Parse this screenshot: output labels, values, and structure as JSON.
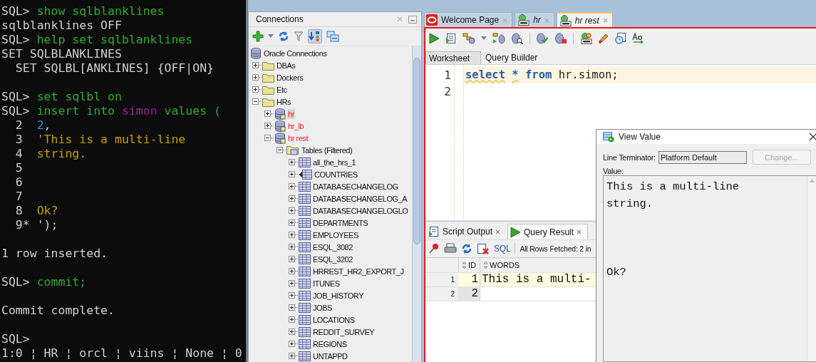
{
  "terminal": {
    "lines": [
      {
        "kind": "text",
        "segments": [
          {
            "text": "SQL> ",
            "kind": "prompt"
          },
          {
            "text": "show sqlblanklines",
            "kind": "command"
          }
        ]
      },
      {
        "kind": "text",
        "segments": [
          {
            "text": "sqlblanklines OFF",
            "kind": "output"
          }
        ]
      },
      {
        "kind": "text",
        "segments": [
          {
            "text": "SQL> ",
            "kind": "prompt"
          },
          {
            "text": "help set sqlblanklines",
            "kind": "command"
          }
        ]
      },
      {
        "kind": "text",
        "segments": [
          {
            "text": "SET SQLBLANKLINES",
            "kind": "output"
          }
        ]
      },
      {
        "kind": "text",
        "segments": [
          {
            "text": "  SET SQLBL[ANKLINES] {OFF|ON}",
            "kind": "output"
          }
        ]
      },
      {
        "kind": "blank"
      },
      {
        "kind": "text",
        "segments": [
          {
            "text": "SQL> ",
            "kind": "prompt"
          },
          {
            "text": "set sqlbl on",
            "kind": "command"
          }
        ]
      },
      {
        "kind": "text",
        "segments": [
          {
            "text": "SQL> ",
            "kind": "prompt"
          },
          {
            "text": "insert into ",
            "kind": "command"
          },
          {
            "text": "simon",
            "kind": "identifier"
          },
          {
            "text": " values (",
            "kind": "command"
          }
        ]
      },
      {
        "kind": "text",
        "segments": [
          {
            "text": "  2  ",
            "kind": "prompt"
          },
          {
            "text": "2",
            "kind": "number"
          },
          {
            "text": ",",
            "kind": "output"
          }
        ]
      },
      {
        "kind": "text",
        "segments": [
          {
            "text": "  3  ",
            "kind": "prompt"
          },
          {
            "text": "'This is a multi-line",
            "kind": "string"
          }
        ]
      },
      {
        "kind": "text",
        "segments": [
          {
            "text": "  4  ",
            "kind": "prompt"
          },
          {
            "text": "string.",
            "kind": "string"
          }
        ]
      },
      {
        "kind": "text",
        "segments": [
          {
            "text": "  5",
            "kind": "prompt"
          }
        ]
      },
      {
        "kind": "text",
        "segments": [
          {
            "text": "  6",
            "kind": "prompt"
          }
        ]
      },
      {
        "kind": "text",
        "segments": [
          {
            "text": "  7",
            "kind": "prompt"
          }
        ]
      },
      {
        "kind": "text",
        "segments": [
          {
            "text": "  8  ",
            "kind": "prompt"
          },
          {
            "text": "Ok?",
            "kind": "string"
          }
        ]
      },
      {
        "kind": "text",
        "segments": [
          {
            "text": "  9* ",
            "kind": "prompt"
          },
          {
            "text": "');",
            "kind": "output"
          }
        ]
      },
      {
        "kind": "blank"
      },
      {
        "kind": "text",
        "segments": [
          {
            "text": "1 row inserted.",
            "kind": "output"
          }
        ]
      },
      {
        "kind": "blank"
      },
      {
        "kind": "text",
        "segments": [
          {
            "text": "SQL> ",
            "kind": "prompt"
          },
          {
            "text": "commit;",
            "kind": "command"
          }
        ]
      },
      {
        "kind": "blank"
      },
      {
        "kind": "text",
        "segments": [
          {
            "text": "Commit complete.",
            "kind": "output"
          }
        ]
      },
      {
        "kind": "blank"
      },
      {
        "kind": "text",
        "segments": [
          {
            "text": "SQL>",
            "kind": "prompt"
          }
        ]
      }
    ],
    "status_bar": "1:0 ¦ HR ¦ orcl ¦ viins ¦ None ¦ 0"
  },
  "connections": {
    "title": "Connections",
    "tree": [
      {
        "label": "Oracle Connections",
        "kind": "root",
        "selected": false,
        "children": [
          {
            "label": "DBAs",
            "kind": "folder",
            "expanded": false,
            "selected": false
          },
          {
            "label": "Dockers",
            "kind": "folder",
            "expanded": false,
            "selected": false
          },
          {
            "label": "Etc",
            "kind": "folder",
            "expanded": false,
            "selected": false
          },
          {
            "label": "HRs",
            "kind": "folder",
            "expanded": true,
            "selected": false,
            "children": [
              {
                "label": "hr",
                "kind": "connection",
                "expanded": false,
                "selected": true
              },
              {
                "label": "hr_lb",
                "kind": "connection",
                "expanded": false,
                "selected": false
              },
              {
                "label": "hr rest",
                "kind": "connection",
                "expanded": true,
                "selected": false,
                "children": [
                  {
                    "label": "Tables (Filtered)",
                    "kind": "tables",
                    "expanded": true,
                    "selected": false,
                    "children": [
                      {
                        "label": "all_the_hrs_1",
                        "kind": "table",
                        "expanded": false,
                        "selected": false
                      },
                      {
                        "label": "COUNTRIES",
                        "kind": "external",
                        "expanded": false,
                        "selected": false
                      },
                      {
                        "label": "DATABASECHANGELOG",
                        "kind": "table",
                        "expanded": false,
                        "selected": false
                      },
                      {
                        "label": "DATABASECHANGELOG_A",
                        "kind": "table",
                        "expanded": false,
                        "selected": false
                      },
                      {
                        "label": "DATABASECHANGELOGLO",
                        "kind": "table",
                        "expanded": false,
                        "selected": false
                      },
                      {
                        "label": "DEPARTMENTS",
                        "kind": "table",
                        "expanded": false,
                        "selected": false
                      },
                      {
                        "label": "EMPLOYEES",
                        "kind": "table",
                        "expanded": false,
                        "selected": false
                      },
                      {
                        "label": "ESQL_3082",
                        "kind": "table",
                        "expanded": false,
                        "selected": false
                      },
                      {
                        "label": "ESQL_3202",
                        "kind": "table",
                        "expanded": false,
                        "selected": false
                      },
                      {
                        "label": "HRREST_HR2_EXPORT_J",
                        "kind": "table",
                        "expanded": false,
                        "selected": false
                      },
                      {
                        "label": "ITUNES",
                        "kind": "table",
                        "expanded": false,
                        "selected": false
                      },
                      {
                        "label": "JOB_HISTORY",
                        "kind": "table",
                        "expanded": false,
                        "selected": false
                      },
                      {
                        "label": "JOBS",
                        "kind": "table",
                        "expanded": false,
                        "selected": false
                      },
                      {
                        "label": "LOCATIONS",
                        "kind": "table",
                        "expanded": false,
                        "selected": false
                      },
                      {
                        "label": "REDDIT_SURVEY",
                        "kind": "table",
                        "expanded": false,
                        "selected": false
                      },
                      {
                        "label": "REGIONS",
                        "kind": "table",
                        "expanded": false,
                        "selected": false
                      },
                      {
                        "label": "UNTAPPD",
                        "kind": "table",
                        "expanded": false,
                        "selected": false
                      }
                    ]
                  }
                ]
              }
            ]
          }
        ]
      }
    ]
  },
  "editor": {
    "tabs": [
      {
        "label": "Welcome Page",
        "kind": "welcome",
        "selected": false
      },
      {
        "label": "hr",
        "kind": "sql",
        "selected": false
      },
      {
        "label": "hr rest",
        "kind": "sql",
        "selected": true
      }
    ],
    "subtabs": [
      {
        "label": "Worksheet",
        "selected": true
      },
      {
        "label": "Query Builder",
        "selected": false
      }
    ],
    "lines": [
      {
        "number": "1",
        "current": true,
        "segments": [
          {
            "text": "select",
            "kind": "keyword",
            "warning": true
          },
          {
            "text": "*",
            "kind": "keyword",
            "warning": true
          },
          {
            "text": "from",
            "kind": "keyword",
            "warning": false
          },
          {
            "text": "hr.simon;",
            "kind": "plain",
            "warning": false
          }
        ]
      },
      {
        "number": "2",
        "current": false
      }
    ]
  },
  "output": {
    "tabs": [
      {
        "label": "Script Output",
        "kind": "script",
        "selected": false
      },
      {
        "label": "Query Result",
        "kind": "result",
        "selected": true
      }
    ],
    "sql_link": "SQL",
    "status": "All Rows Fetched: 2 in",
    "grid": {
      "columns": [
        "ID",
        "WORDS"
      ],
      "rows": [
        {
          "number": "1",
          "selected": true,
          "cells": [
            "1",
            "This is a multi-"
          ]
        },
        {
          "number": "2",
          "selected": false,
          "cells": [
            "2"
          ]
        }
      ]
    }
  },
  "dialog": {
    "title": "View Value",
    "terminator_label": "Line Terminator:",
    "terminator_value": "Platform Default",
    "change_button": {
      "label": "Change...",
      "disabled": true
    },
    "value_label": "Value:",
    "value": "This is a multi-line\nstring.\n\n\n\nOk?"
  }
}
